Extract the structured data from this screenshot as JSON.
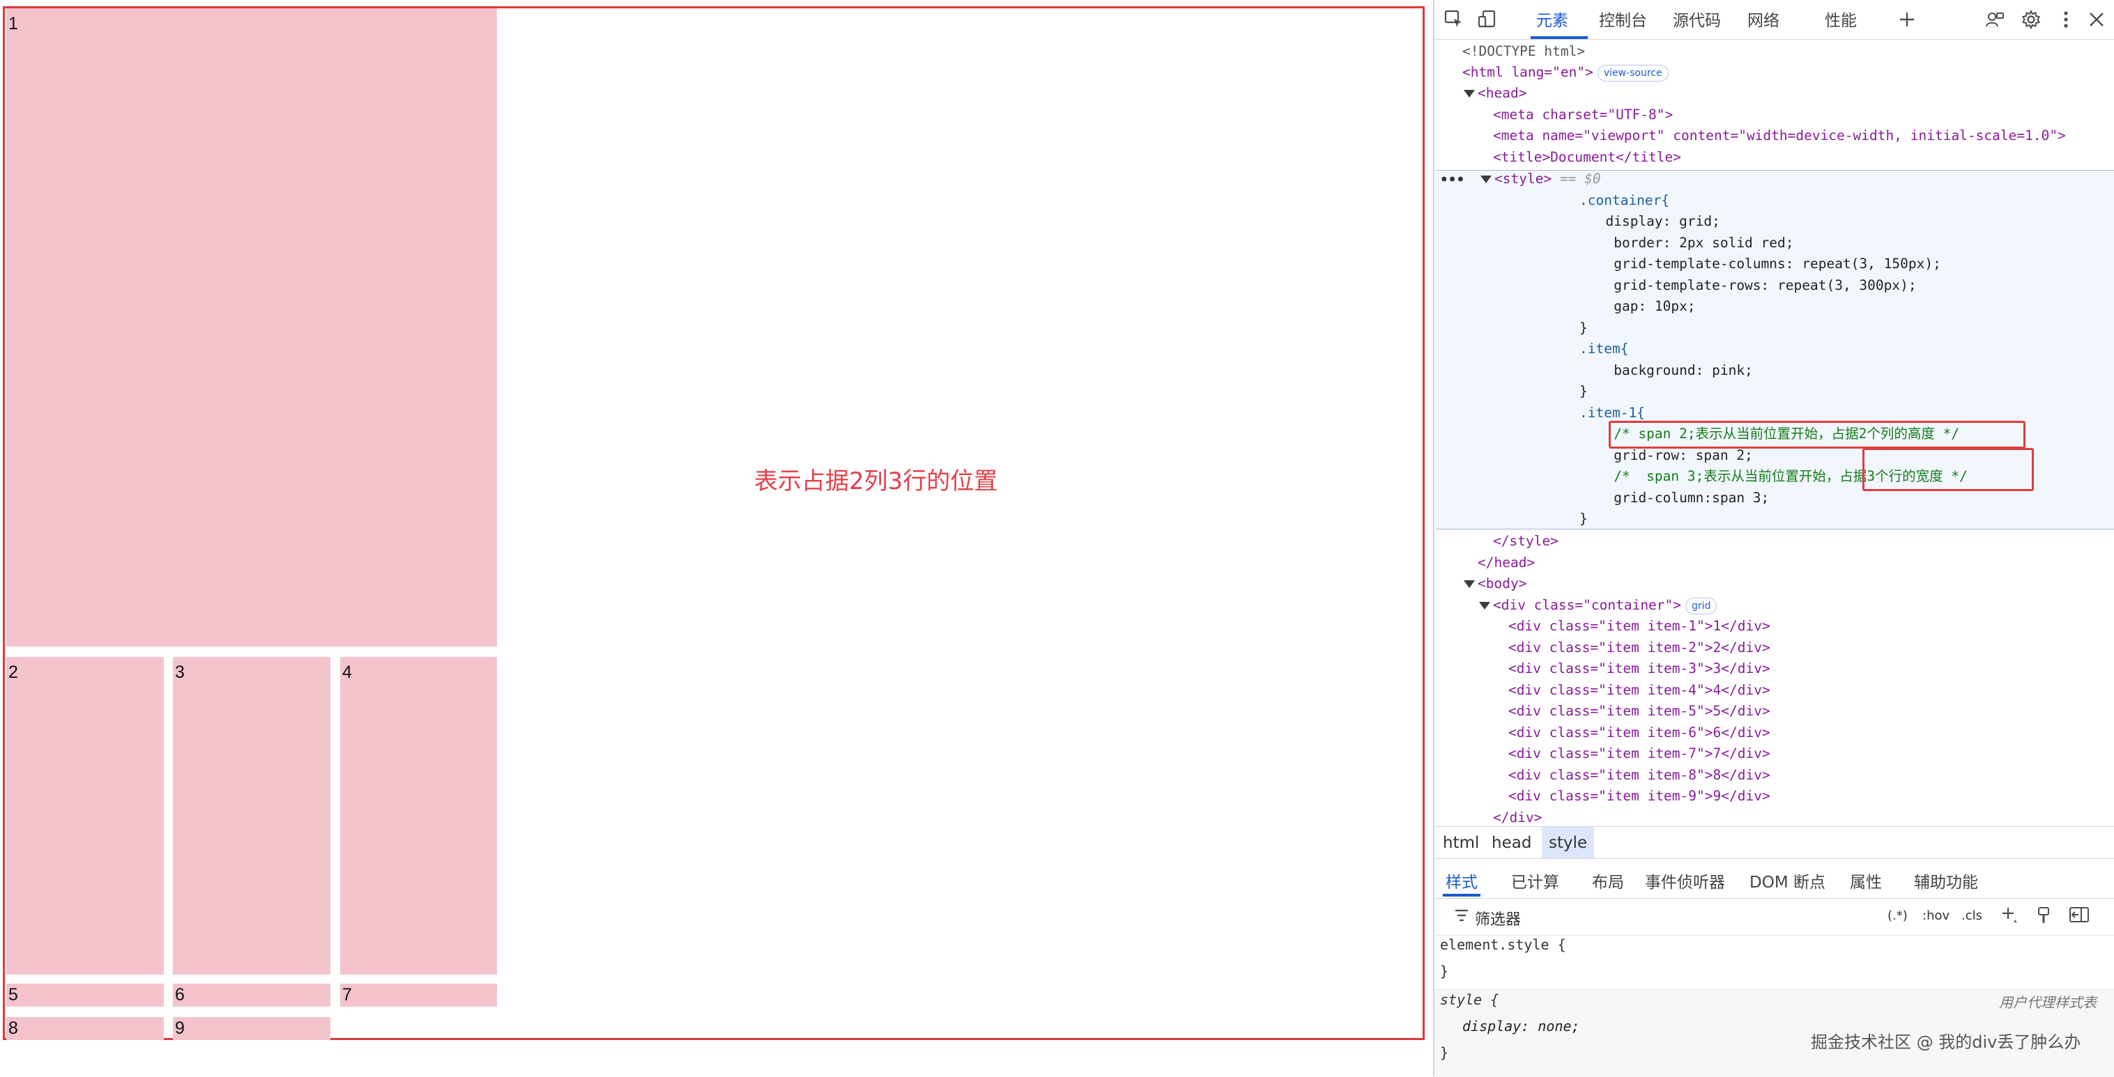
{
  "preview": {
    "items": [
      "1",
      "2",
      "3",
      "4",
      "5",
      "6",
      "7",
      "8",
      "9"
    ],
    "annotation": "表示占据2列3行的位置"
  },
  "devtools": {
    "tabs": [
      "元素",
      "控制台",
      "源代码",
      "网络",
      "性能"
    ],
    "code": {
      "doctype": "<!DOCTYPE html>",
      "html_open": "<html lang=\"en\">",
      "view_source": "view-source",
      "head_open": "<head>",
      "meta_charset": "<meta charset=\"UTF-8\">",
      "meta_viewport": "<meta name=\"viewport\" content=\"width=device-width, initial-scale=1.0\">",
      "title": "<title>Document</title>",
      "style_open": "<style>",
      "style_ref": "== $0",
      "css": [
        ".container{",
        "  display: grid;",
        "   border: 2px solid red;",
        "   grid-template-columns: repeat(3, 150px);",
        "   grid-template-rows: repeat(3, 300px);",
        "   gap: 10px;",
        "}",
        ".item{",
        "   background: pink;",
        "}",
        ".item-1{",
        "   /* span 2;表示从当前位置开始，占据2个列的高度 */",
        "   grid-row: span 2;",
        "   /*  span 3;表示从当前位置开始，占据3个行的宽度 */",
        "   grid-column:span 3;",
        "}"
      ],
      "style_close": "</style>",
      "head_close": "</head>",
      "body_open": "<body>",
      "div_open": "<div class=\"container\">",
      "grid_badge": "grid",
      "items": [
        "<div class=\"item item-1\">1</div>",
        "<div class=\"item item-2\">2</div>",
        "<div class=\"item item-3\">3</div>",
        "<div class=\"item item-4\">4</div>",
        "<div class=\"item item-5\">5</div>",
        "<div class=\"item item-6\">6</div>",
        "<div class=\"item item-7\">7</div>",
        "<div class=\"item item-8\">8</div>",
        "<div class=\"item item-9\">9</div>"
      ],
      "div_close": "</div>"
    },
    "breadcrumbs": [
      "html",
      "head",
      "style"
    ],
    "subtabs": [
      "样式",
      "已计算",
      "布局",
      "事件侦听器",
      "DOM 断点",
      "属性",
      "辅助功能"
    ],
    "filter": {
      "label": "筛选器",
      "regex": "(.*)",
      "hov": ":hov",
      "cls": ".cls"
    },
    "styles": {
      "element_style": "element.style {",
      "close": "}",
      "style_sel": "style {",
      "ua_label": "用户代理样式表",
      "display_decl": "display: none;",
      "watermark": "掘金技术社区 @ 我的div丢了肿么办"
    }
  }
}
